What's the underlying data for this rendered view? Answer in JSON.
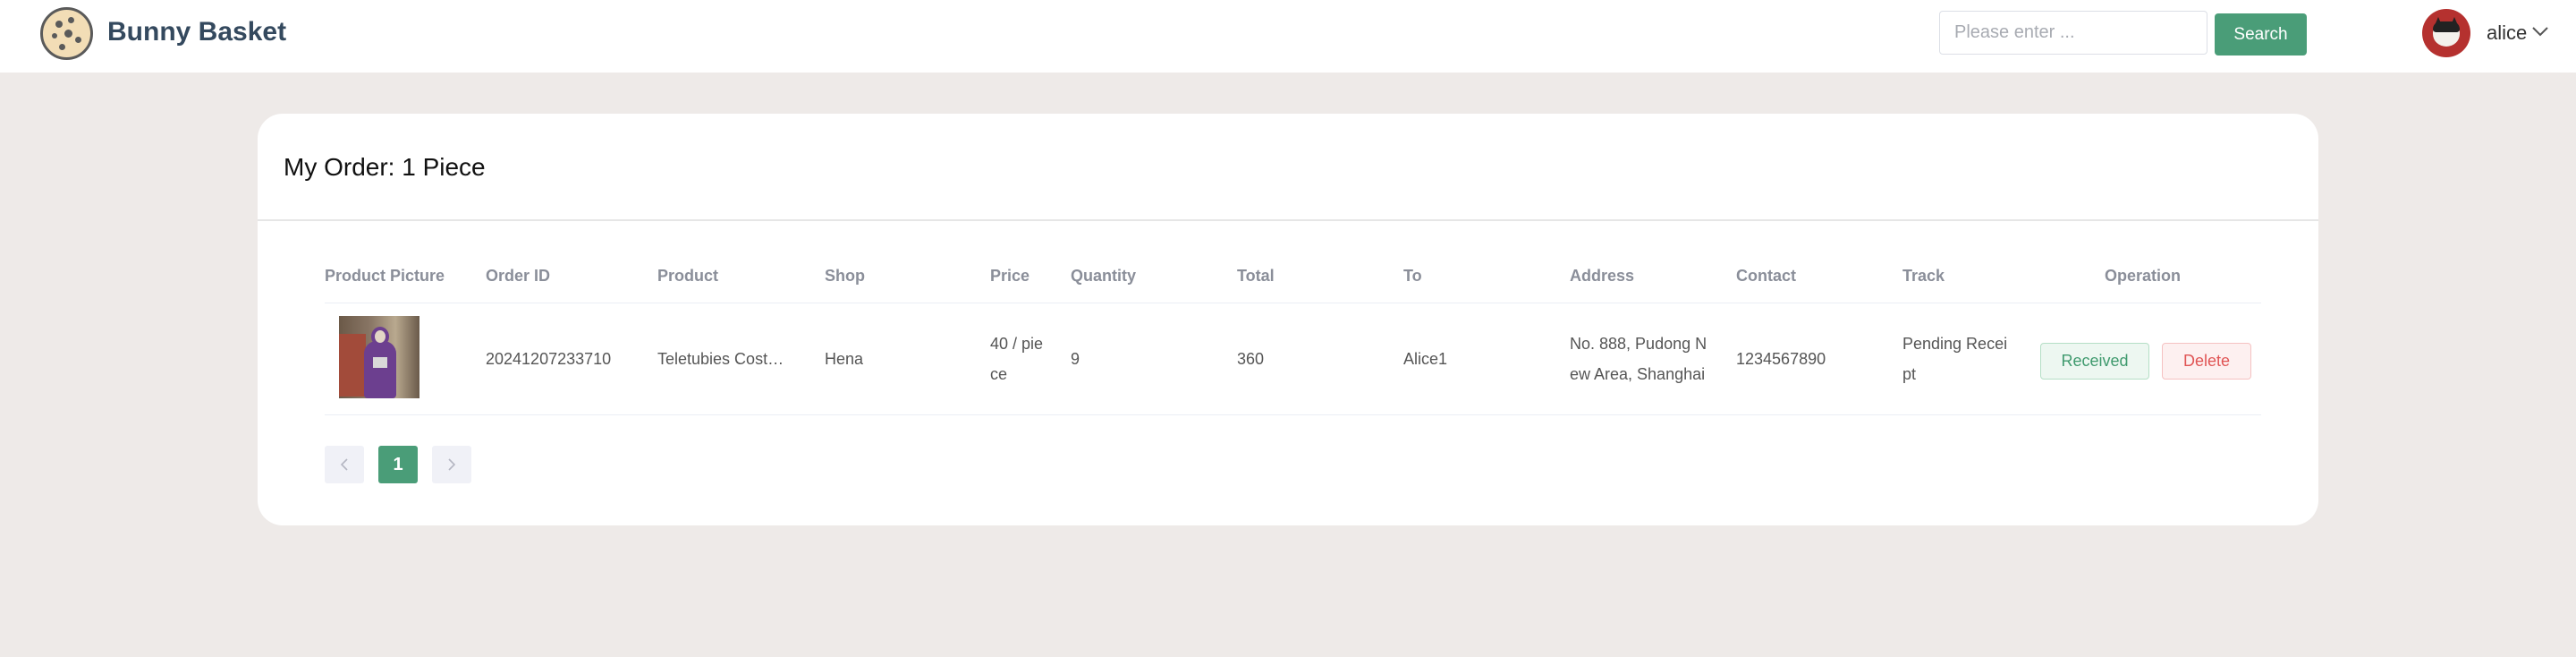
{
  "header": {
    "brand": "Bunny Basket",
    "search_placeholder": "Please enter ...",
    "search_label": "Search",
    "username": "alice"
  },
  "main": {
    "title": "My Order: 1 Piece",
    "columns": [
      "Product Picture",
      "Order ID",
      "Product",
      "Shop",
      "Price",
      "Quantity",
      "Total",
      "To",
      "Address",
      "Contact",
      "Track",
      "Operation"
    ],
    "rows": [
      {
        "order_id": "20241207233710",
        "product": "Teletubies Costume",
        "shop": "Hena",
        "price": "40 / piece",
        "quantity": "9",
        "total": "360",
        "to": "Alice1",
        "address": "No. 888, Pudong New Area, Shanghai",
        "contact": "1234567890",
        "track": "Pending Receipt",
        "received_label": "Received",
        "delete_label": "Delete"
      }
    ],
    "pagination": {
      "current": "1"
    }
  },
  "colors": {
    "accent": "#4a9d78",
    "background": "#eeeae8",
    "delete": "#e05555"
  }
}
